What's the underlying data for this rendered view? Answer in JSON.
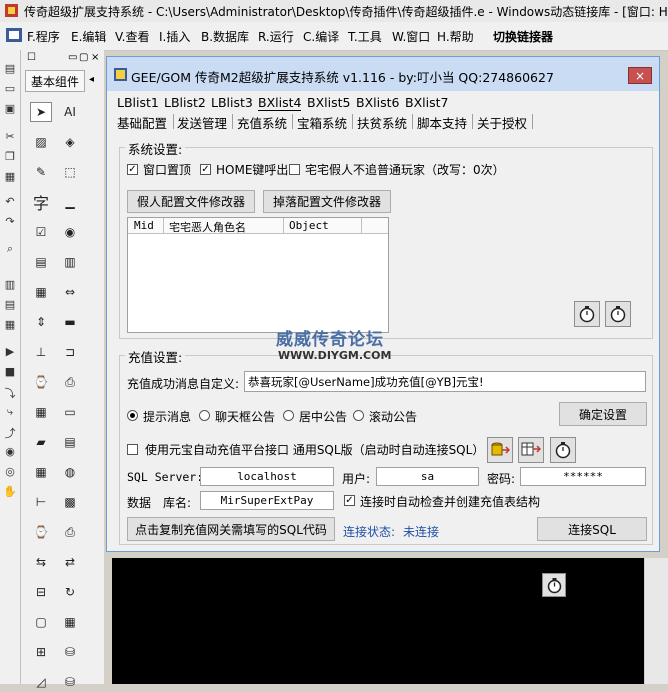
{
  "window": {
    "title": "传奇超级扩展支持系统 - C:\\Users\\Administrator\\Desktop\\传奇插件\\传奇超级插件.e - Windows动态链接库 - [窗口: H"
  },
  "menu": {
    "items": [
      "F.程序",
      "E.编辑",
      "V.查看",
      "I.插入",
      "B.数据库",
      "R.运行",
      "C.编译",
      "T.工具",
      "W.窗口",
      "H.帮助"
    ],
    "switch_linker": "切换链接器"
  },
  "toolbox": {
    "title": "基本组件",
    "controls": {
      "label_text": "AI",
      "editbox_text": "字"
    }
  },
  "dialog": {
    "title": "GEE/GOM 传奇M2超级扩展支持系统 v1.116 - by:叮小当 QQ:274860627",
    "close": "×",
    "tabs_row1": [
      "LBlist1",
      "LBlist2",
      "LBlist3",
      "BXlist4",
      "BXlist5",
      "BXlist6",
      "BXlist7"
    ],
    "tabs_row2": [
      "基础配置",
      "发送管理",
      "充值系统",
      "宝箱系统",
      "扶贫系统",
      "脚本支持",
      "关于授权"
    ],
    "system": {
      "legend": "系统设置:",
      "window_top": "窗口置顶",
      "home_key": "HOME键呼出",
      "fake_players": "宅宅假人不追普通玩家（改写：0次）",
      "fake_config_btn": "假人配置文件修改器",
      "drop_config_btn": "掉落配置文件修改器",
      "table_headers": [
        "Mid",
        "宅宅恶人角色名",
        "Object"
      ]
    },
    "recharge": {
      "legend": "充值设置:",
      "msg_label": "充值成功消息自定义:",
      "msg_value": "恭喜玩家[@UserName]成功充值[@YB]元宝!",
      "radios": [
        "提示消息",
        "聊天框公告",
        "居中公告",
        "滚动公告"
      ],
      "confirm_btn": "确定设置",
      "auto_recharge": "使用元宝自动充值平台接口 通用SQL版（启动时自动连接SQL）",
      "sql_server_label": "SQL Server:",
      "sql_server_value": "localhost",
      "user_label": "用户:",
      "user_value": "sa",
      "password_label": "密码:",
      "password_value": "******",
      "db_label": "数据",
      "lib_label": "库名:",
      "db_value": "MirSuperExtPay",
      "auto_check": "连接时自动检查并创建充值表结构",
      "copy_sql_btn": "点击复制充值网关需填写的SQL代码",
      "status_label": "连接状态:",
      "status_value": "未连接",
      "connect_btn": "连接SQL"
    }
  },
  "watermark": {
    "line1": "威威传奇论坛",
    "line2": "WWW.DIYGM.COM"
  }
}
